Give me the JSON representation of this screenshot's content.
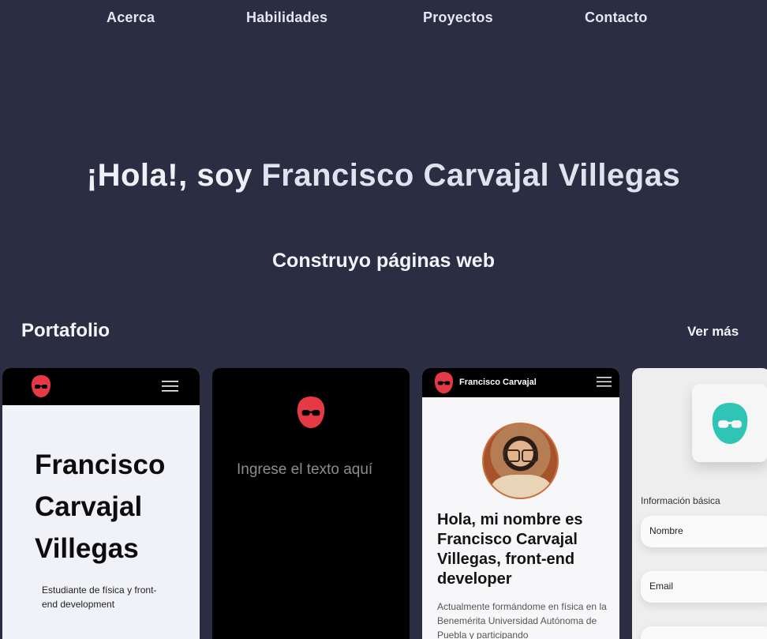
{
  "nav": {
    "items": [
      {
        "label": "Acerca"
      },
      {
        "label": "Habilidades"
      },
      {
        "label": "Proyectos"
      },
      {
        "label": "Contacto"
      }
    ]
  },
  "hero": {
    "greeting": "¡Hola!, soy ",
    "name": "Francisco Carvajal Villegas",
    "subtitle": "Construyo páginas web"
  },
  "portfolio": {
    "title": "Portafolio",
    "see_more": "Ver más",
    "cards": [
      {
        "heading": "Francisco Carvajal Villegas",
        "text": "Estudiante de física y front-end development"
      },
      {
        "placeholder": "Ingrese el texto aquí"
      },
      {
        "brand": "Francisco Carvajal",
        "heading": "Hola, mi nombre es Francisco Carvajal Villegas, front-end developer",
        "text": "Actualmente formándome en física en la Benemérita Universidad Autónoma de Puebla y participando"
      },
      {
        "section_label": "Información básica",
        "fields": [
          {
            "placeholder": "Nombre"
          },
          {
            "placeholder": "Email"
          }
        ]
      }
    ]
  },
  "colors": {
    "background": "#2b2d42",
    "logo_red": "#e63946",
    "logo_teal": "#2ec4b6"
  },
  "icons": {
    "logo": "face-with-sunglasses-icon",
    "menu": "hamburger-menu-icon"
  }
}
